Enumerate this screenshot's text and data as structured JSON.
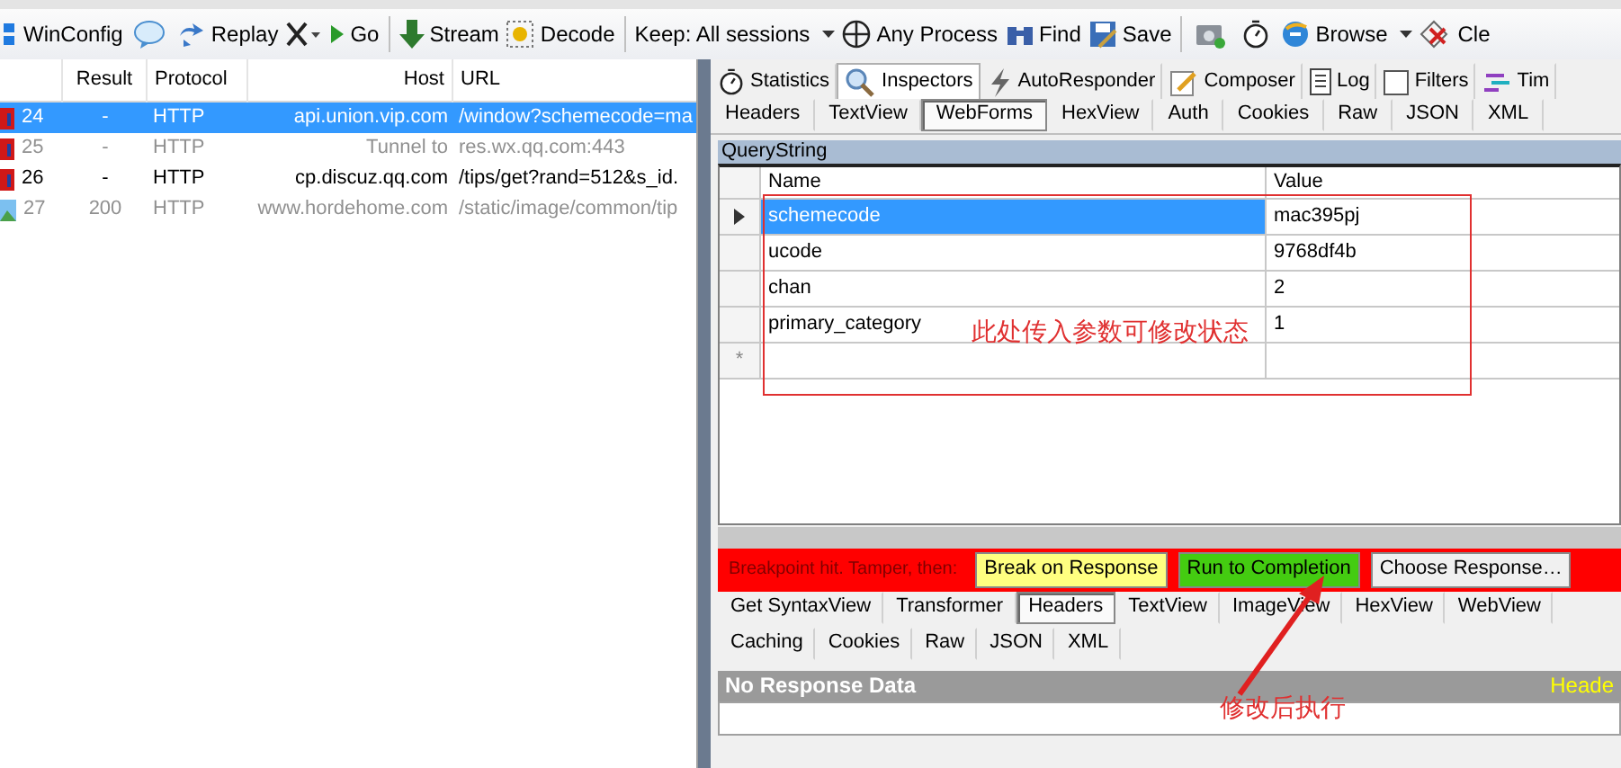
{
  "toolbar": [
    {
      "kind": "button",
      "label": "WinConfig"
    },
    {
      "kind": "icon"
    },
    {
      "kind": "button",
      "label": "Replay"
    },
    {
      "kind": "dropdown-icon"
    },
    {
      "kind": "button",
      "label": "Go"
    },
    {
      "kind": "separator"
    },
    {
      "kind": "button",
      "label": "Stream"
    },
    {
      "kind": "button",
      "label": "Decode"
    },
    {
      "kind": "separator"
    },
    {
      "kind": "dropdown",
      "label": "Keep: All sessions"
    },
    {
      "kind": "button",
      "label": "Any Process"
    },
    {
      "kind": "button",
      "label": "Find"
    },
    {
      "kind": "button",
      "label": "Save"
    },
    {
      "kind": "separator"
    },
    {
      "kind": "icon"
    },
    {
      "kind": "icon"
    },
    {
      "kind": "dropdown",
      "label": "Browse"
    },
    {
      "kind": "button",
      "label": "Cle"
    }
  ],
  "sessions": {
    "columns": [
      "Result",
      "Protocol",
      "Host",
      "URL"
    ],
    "rows": [
      {
        "kind": "script",
        "num": "24",
        "result": "-",
        "protocol": "HTTP",
        "host": "api.union.vip.com",
        "url": "/window?schemecode=ma",
        "selected": true,
        "dimmed": false
      },
      {
        "kind": "script",
        "num": "25",
        "result": "-",
        "protocol": "HTTP",
        "host": "Tunnel to",
        "url": "res.wx.qq.com:443",
        "selected": false,
        "dimmed": true
      },
      {
        "kind": "script",
        "num": "26",
        "result": "-",
        "protocol": "HTTP",
        "host": "cp.discuz.qq.com",
        "url": "/tips/get?rand=512&s_id.",
        "selected": false,
        "dimmed": false
      },
      {
        "kind": "image",
        "num": "27",
        "result": "200",
        "protocol": "HTTP",
        "host": "www.hordehome.com",
        "url": "/static/image/common/tip",
        "selected": false,
        "dimmed": true
      }
    ]
  },
  "inspector_tabs": [
    {
      "label": "Statistics",
      "selected": false
    },
    {
      "label": "Inspectors",
      "selected": true
    },
    {
      "label": "AutoResponder",
      "selected": false
    },
    {
      "label": "Composer",
      "selected": false
    },
    {
      "label": "Log",
      "selected": false
    },
    {
      "label": "Filters",
      "selected": false
    },
    {
      "label": "Tim",
      "selected": false
    }
  ],
  "request_tabs": [
    {
      "label": "Headers",
      "selected": false
    },
    {
      "label": "TextView",
      "selected": false
    },
    {
      "label": "WebForms",
      "selected": true
    },
    {
      "label": "HexView",
      "selected": false
    },
    {
      "label": "Auth",
      "selected": false
    },
    {
      "label": "Cookies",
      "selected": false
    },
    {
      "label": "Raw",
      "selected": false
    },
    {
      "label": "JSON",
      "selected": false
    },
    {
      "label": "XML",
      "selected": false
    }
  ],
  "query_string": {
    "title": "QueryString",
    "columns": [
      "Name",
      "Value"
    ],
    "new_row_marker": "*",
    "rows": [
      {
        "name": "schemecode",
        "value": "mac395pj",
        "selected": true
      },
      {
        "name": "ucode",
        "value": "9768df4b",
        "selected": false
      },
      {
        "name": "chan",
        "value": "2",
        "selected": false
      },
      {
        "name": "primary_category",
        "value": "1",
        "selected": false
      }
    ]
  },
  "breakpoint_bar": {
    "label": "Breakpoint hit. Tamper, then:",
    "buttons": [
      {
        "label": "Break on Response",
        "color": "#ffff80"
      },
      {
        "label": "Run to Completion",
        "color": "#44cc11"
      },
      {
        "label": "Choose Response…",
        "color": "#f0f0f0"
      }
    ]
  },
  "response_tab_rows": [
    {
      "tabs": [
        {
          "label": "Get SyntaxView",
          "selected": false
        },
        {
          "label": "Transformer",
          "selected": false
        },
        {
          "label": "Headers",
          "selected": true
        },
        {
          "label": "TextView",
          "selected": false
        },
        {
          "label": "ImageView",
          "selected": false
        },
        {
          "label": "HexView",
          "selected": false
        },
        {
          "label": "WebView",
          "selected": false
        }
      ]
    },
    {
      "tabs": [
        {
          "label": "Caching",
          "selected": false
        },
        {
          "label": "Cookies",
          "selected": false
        },
        {
          "label": "Raw",
          "selected": false
        },
        {
          "label": "JSON",
          "selected": false
        },
        {
          "label": "XML",
          "selected": false
        }
      ]
    }
  ],
  "response": {
    "title": "No Response Data",
    "hint": "Heade"
  },
  "annotations": {
    "note": "此处传入参数可修改状态",
    "action_note": "修改后执行"
  }
}
